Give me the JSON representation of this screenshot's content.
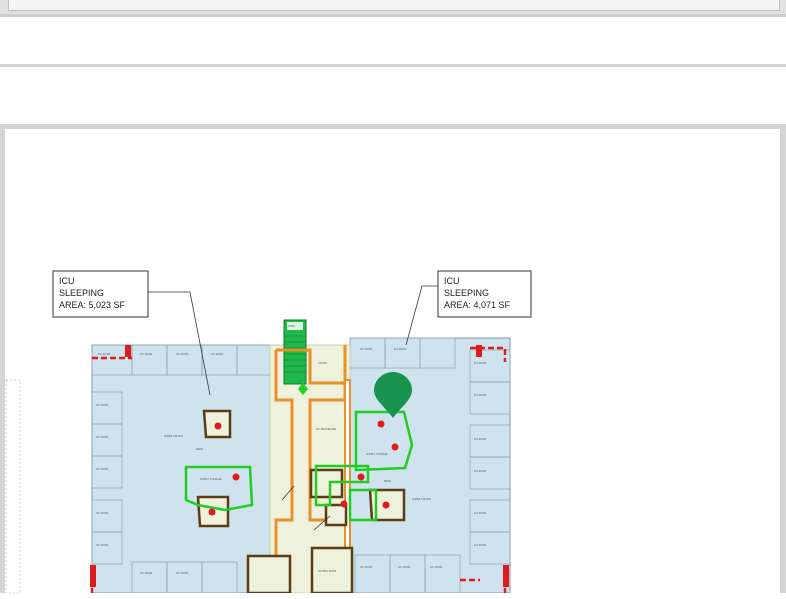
{
  "callouts": {
    "left": {
      "line1": "ICU",
      "line2": "SLEEPING",
      "line3": "AREA: 5,023 SF"
    },
    "right": {
      "line1": "ICU",
      "line2": "SLEEPING",
      "line3": "AREA: 4,071 SF"
    }
  },
  "room_labels": {
    "icu_room": "ICU ROOM",
    "nurse_station": "NURSE STATION",
    "supply_storage": "SUPPLY STORAGE",
    "office": "OFFICE",
    "procedure": "ICU PROCEDURE",
    "stair": "STAIR",
    "waiting_room": "WAITING ROOM",
    "meds": "MEDS"
  },
  "colors": {
    "icu_area": "#cfe3ee",
    "corridor": "#eef2dc",
    "boundary": "#e8902a",
    "utility": "#22cc22",
    "marker": "#17934f",
    "egress": "#e01b1b"
  },
  "marker_icon": "map-pin-icon"
}
